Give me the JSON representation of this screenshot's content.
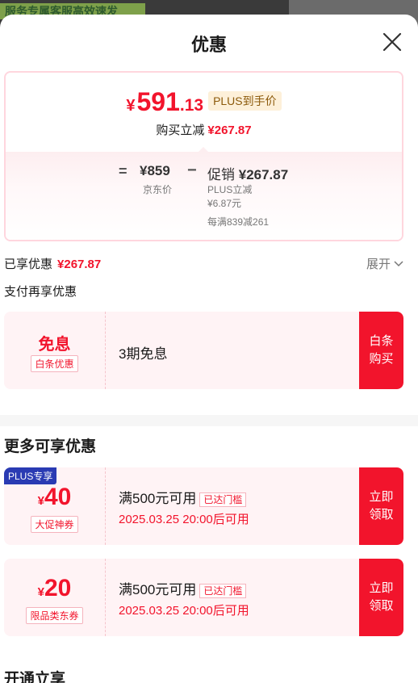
{
  "backdrop": {
    "text": "服务专属客服高效速发"
  },
  "header": {
    "title": "优惠"
  },
  "summary": {
    "currency": "¥",
    "price_int": "591",
    "price_dec": ".13",
    "plus_tag": "PLUS到手价",
    "reduce_label": "购买立减",
    "reduce_amount": "¥267.87",
    "equals": "=",
    "jd_price": "¥859",
    "jd_price_label": "京东价",
    "minus": "−",
    "promo_label": "促销",
    "promo_amount": "¥267.87",
    "plus_reduce_label": "PLUS立减",
    "plus_reduce_amount": "¥6.87元",
    "every_full": "每满839减261"
  },
  "enjoyed": {
    "label": "已享优惠",
    "amount": "¥267.87",
    "expand_label": "展开"
  },
  "pay_more": {
    "title": "支付再享优惠"
  },
  "baitiao_card": {
    "title": "免息",
    "tag": "白条优惠",
    "desc": "3期免息",
    "button": "白条购买"
  },
  "more_title": "更多可享优惠",
  "coupons": [
    {
      "badge": "PLUS专享",
      "currency": "¥",
      "amount": "40",
      "tag": "大促神券",
      "condition": "满500元可用",
      "status": "已达门槛",
      "time": "2025.03.25 20:00后可用",
      "button": "立即领取"
    },
    {
      "badge": "",
      "currency": "¥",
      "amount": "20",
      "tag": "限品类东券",
      "condition": "满500元可用",
      "status": "已达门槛",
      "time": "2025.03.25 20:00后可用",
      "button": "立即领取"
    }
  ],
  "open_title": "开通立享",
  "colors": {
    "accent": "#f2142c",
    "plus_badge": "#2a3bb3",
    "plus_tag_bg": "#fdf0d9"
  }
}
